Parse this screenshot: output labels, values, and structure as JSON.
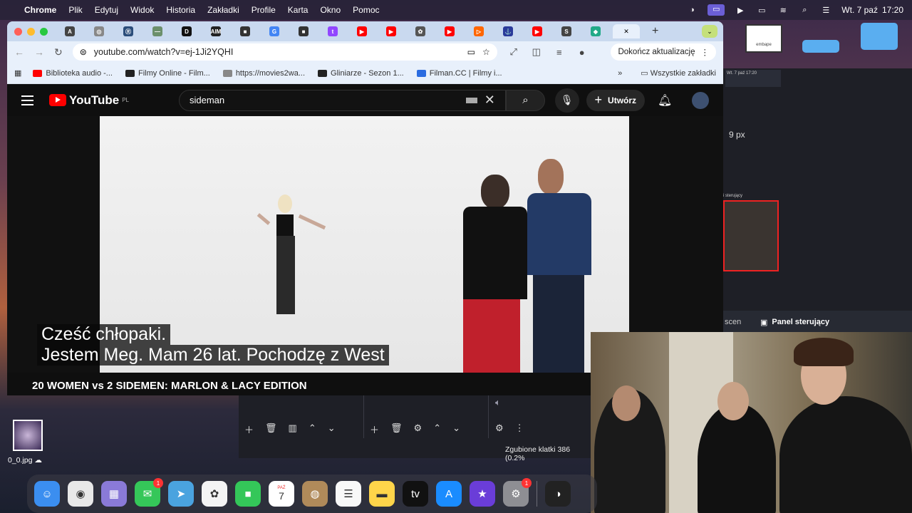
{
  "menubar": {
    "app": "Chrome",
    "items": [
      "Plik",
      "Edytuj",
      "Widok",
      "Historia",
      "Zakładki",
      "Profile",
      "Karta",
      "Okno",
      "Pomoc"
    ],
    "clock_day": "Wt. 7 paź",
    "clock_time": "17:20"
  },
  "chrome": {
    "tabs": [
      {
        "icon": "A",
        "color": "#444"
      },
      {
        "icon": "◎",
        "color": "#888"
      },
      {
        "icon": "Ⓡ",
        "color": "#2b4d7a"
      },
      {
        "icon": "—",
        "color": "#6b8f6b"
      },
      {
        "icon": "D",
        "color": "#111"
      },
      {
        "icon": "AIM",
        "color": "#222"
      },
      {
        "icon": "■",
        "color": "#333"
      },
      {
        "icon": "G",
        "color": "#4285f4"
      },
      {
        "icon": "■",
        "color": "#333"
      },
      {
        "icon": "t",
        "color": "#9146ff"
      },
      {
        "icon": "▶",
        "color": "#f00"
      },
      {
        "icon": "▶",
        "color": "#f00"
      },
      {
        "icon": "✿",
        "color": "#555"
      },
      {
        "icon": "▶",
        "color": "#f00"
      },
      {
        "icon": "▷",
        "color": "#f60"
      },
      {
        "icon": "⚓",
        "color": "#2a3a9a"
      },
      {
        "icon": "▶",
        "color": "#f00"
      },
      {
        "icon": "S",
        "color": "#444"
      },
      {
        "icon": "◆",
        "color": "#2a8"
      }
    ],
    "url": "youtube.com/watch?v=ej-1Ji2YQHI",
    "update_label": "Dokończ aktualizację",
    "bookmarks": [
      {
        "label": "Biblioteka audio -...",
        "color": "#f00"
      },
      {
        "label": "Filmy Online - Film...",
        "color": "#222"
      },
      {
        "label": "https://movies2wa...",
        "color": "#888"
      },
      {
        "label": "Gliniarze - Sezon 1...",
        "color": "#222"
      },
      {
        "label": "Filman.CC | Filmy i...",
        "color": "#2a6be0"
      }
    ],
    "bookmarks_more": "»",
    "all_bookmarks": "Wszystkie zakładki"
  },
  "youtube": {
    "region": "PL",
    "search_value": "sideman",
    "create_label": "Utwórz",
    "subtitle_line1": "Cześć chłopaki.",
    "subtitle_line2": "Jestem Meg.  Mam 26 lat. Pochodzę z West",
    "video_title": "20 WOMEN vs 2 SIDEMEN: MARLON & LACY EDITION"
  },
  "obs": {
    "mini_time": "Wt. 7 paź 17:20",
    "px_text": "9 px",
    "source_label": "i sterujący",
    "scenes_label": "scen",
    "panel_label": "Panel sterujący",
    "status": "Zgubione klatki 386 (0.2%"
  },
  "desktop": {
    "embape_label": "embape",
    "file_label": "0_0.jpg"
  },
  "dock": {
    "apps": [
      {
        "name": "finder-icon",
        "glyph": "☺",
        "bg": "#3b8ef0"
      },
      {
        "name": "chrome-icon",
        "glyph": "◉",
        "bg": "#e8e8e8"
      },
      {
        "name": "launchpad-icon",
        "glyph": "▦",
        "bg": "#8a7ad8"
      },
      {
        "name": "messages-icon",
        "glyph": "✉",
        "bg": "#35c759",
        "badge": "1"
      },
      {
        "name": "maps-icon",
        "glyph": "➤",
        "bg": "#4aa3df"
      },
      {
        "name": "photos-icon",
        "glyph": "✿",
        "bg": "#f4f4f4"
      },
      {
        "name": "facetime-icon",
        "glyph": "■",
        "bg": "#34c759"
      },
      {
        "name": "calendar-icon",
        "glyph": "7",
        "bg": "#fff",
        "subtext": "PAŹ"
      },
      {
        "name": "contacts-icon",
        "glyph": "◍",
        "bg": "#b08a5a"
      },
      {
        "name": "reminders-icon",
        "glyph": "☰",
        "bg": "#f8f8f8"
      },
      {
        "name": "notes-icon",
        "glyph": "▬",
        "bg": "#ffd54a"
      },
      {
        "name": "appletv-icon",
        "glyph": "tv",
        "bg": "#111"
      },
      {
        "name": "appstore-icon",
        "glyph": "A",
        "bg": "#1a8cff"
      },
      {
        "name": "imovie-icon",
        "glyph": "★",
        "bg": "#6a3dd8"
      },
      {
        "name": "settings-icon",
        "glyph": "⚙",
        "bg": "#8e8e93",
        "badge": "1"
      },
      {
        "name": "obs-icon",
        "glyph": "◑",
        "bg": "#222"
      }
    ]
  }
}
